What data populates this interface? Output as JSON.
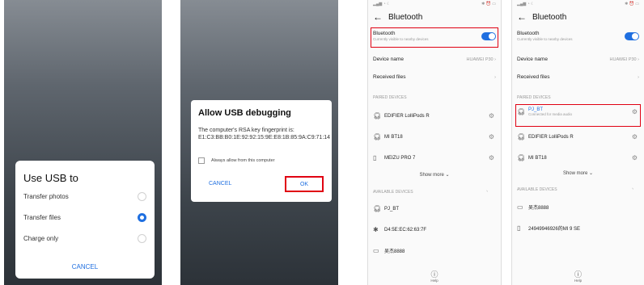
{
  "usb_dialog": {
    "title": "Use USB to",
    "options": [
      "Transfer photos",
      "Transfer files",
      "Charge only"
    ],
    "selected_index": 1,
    "cancel": "CANCEL"
  },
  "debug_dialog": {
    "title": "Allow USB debugging",
    "fingerprint": "The computer's RSA key fingerprint is: E1:C3:BB:B0:1E:92:92:15:9E:E8:1B:85:9A:C9:71:14",
    "always_allow": "Always allow from this computer",
    "cancel": "CANCEL",
    "ok": "OK"
  },
  "bt1": {
    "title": "Bluetooth",
    "bt_label": "Bluetooth",
    "bt_sub": "Currently visible to nearby devices",
    "device_name_label": "Device name",
    "device_name_value": "HUAWEI P30",
    "received_files": "Received files",
    "paired_header": "PAIRED DEVICES",
    "paired": [
      "EDIFIER LolliPods R",
      "MI BT18",
      "MEIZU PRO 7"
    ],
    "show_more": "Show more",
    "available_header": "AVAILABLE DEVICES",
    "available": [
      "PJ_BT",
      "D4:5E:EC:62:63:7F",
      "吴杰8888"
    ],
    "help": "Help"
  },
  "bt2": {
    "title": "Bluetooth",
    "bt_label": "Bluetooth",
    "bt_sub": "Currently visible to nearby devices",
    "device_name_label": "Device name",
    "device_name_value": "HUAWEI P30",
    "received_files": "Received files",
    "paired_header": "PAIRED DEVICES",
    "paired_connected": "PJ_BT",
    "paired_connected_sub": "Connected for media audio",
    "paired": [
      "EDIFIER LolliPods R",
      "MI BT18"
    ],
    "show_more": "Show more",
    "available_header": "AVAILABLE DEVICES",
    "available": [
      "吴杰8888",
      "24949946926的MI 9 SE"
    ],
    "help": "Help"
  },
  "colors": {
    "accent": "#1f6fe0",
    "highlight": "#e00012"
  }
}
